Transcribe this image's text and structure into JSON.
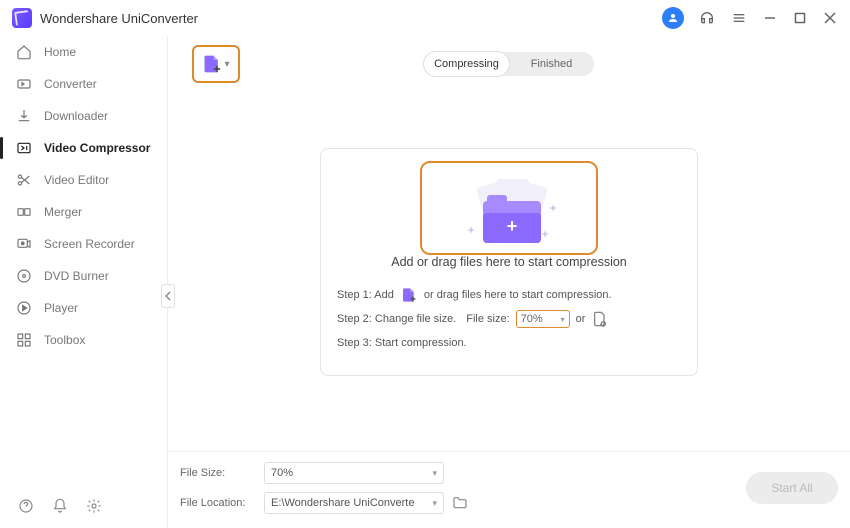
{
  "app_title": "Wondershare UniConverter",
  "sidebar": {
    "items": [
      {
        "label": "Home"
      },
      {
        "label": "Converter"
      },
      {
        "label": "Downloader"
      },
      {
        "label": "Video Compressor"
      },
      {
        "label": "Video Editor"
      },
      {
        "label": "Merger"
      },
      {
        "label": "Screen Recorder"
      },
      {
        "label": "DVD Burner"
      },
      {
        "label": "Player"
      },
      {
        "label": "Toolbox"
      }
    ]
  },
  "tabs": {
    "compressing": "Compressing",
    "finished": "Finished"
  },
  "drop": {
    "text": "Add or drag files here to start compression"
  },
  "steps": {
    "s1a": "Step 1: Add",
    "s1b": "or drag files here to start compression.",
    "s2a": "Step 2: Change file size.",
    "s2b": "File size:",
    "s2value": "70%",
    "s2or": "or",
    "s3": "Step 3: Start compression."
  },
  "bottom": {
    "file_size_label": "File Size:",
    "file_size_value": "70%",
    "file_loc_label": "File Location:",
    "file_loc_value": "E:\\Wondershare UniConverte",
    "start_all": "Start All"
  }
}
